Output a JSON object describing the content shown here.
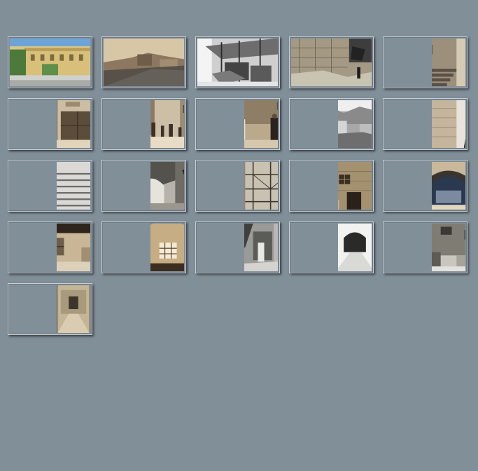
{
  "gallery": {
    "background": "#818f99",
    "items": [
      {
        "caption": "",
        "scene": "color-building",
        "layout": "full"
      },
      {
        "caption": "",
        "scene": "street-sepia",
        "layout": "full"
      },
      {
        "caption": "",
        "scene": "market-bw",
        "layout": "full"
      },
      {
        "caption": "",
        "scene": "wall-rubble",
        "layout": "full"
      },
      {
        "caption": "",
        "scene": "stone-steps",
        "layout": "right"
      },
      {
        "caption": "",
        "scene": "doorway",
        "layout": "right"
      },
      {
        "caption": "",
        "scene": "alley-crowd",
        "layout": "right"
      },
      {
        "caption": "",
        "scene": "two-men",
        "layout": "right"
      },
      {
        "caption": "",
        "scene": "rooftops",
        "layout": "right"
      },
      {
        "caption": "",
        "scene": "wall-ladder",
        "layout": "right"
      },
      {
        "caption": "",
        "scene": "white-stairs",
        "layout": "right"
      },
      {
        "caption": "",
        "scene": "arch-tree",
        "layout": "right"
      },
      {
        "caption": "",
        "scene": "scaffolding",
        "layout": "right"
      },
      {
        "caption": "",
        "scene": "facade-window",
        "layout": "right"
      },
      {
        "caption": "",
        "scene": "arched-gate",
        "layout": "right"
      },
      {
        "caption": "",
        "scene": "dark-window",
        "layout": "right"
      },
      {
        "caption": "",
        "scene": "lit-window",
        "layout": "right"
      },
      {
        "caption": "",
        "scene": "vine-door",
        "layout": "right"
      },
      {
        "caption": "",
        "scene": "bright-alley",
        "layout": "right"
      },
      {
        "caption": "",
        "scene": "old-house",
        "layout": "right"
      },
      {
        "caption": "",
        "scene": "narrow-lane",
        "layout": "right"
      }
    ]
  }
}
